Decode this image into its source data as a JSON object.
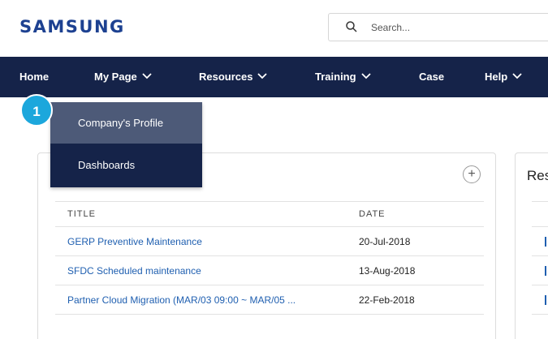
{
  "brand": {
    "logo_text": "SAMSUNG",
    "logo_color": "#1d4191"
  },
  "search": {
    "placeholder": "Search..."
  },
  "nav": {
    "bg_color": "#152349",
    "items": [
      {
        "label": "Home",
        "has_dropdown": false
      },
      {
        "label": "My Page",
        "has_dropdown": true
      },
      {
        "label": "Resources",
        "has_dropdown": true
      },
      {
        "label": "Training",
        "has_dropdown": true
      },
      {
        "label": "Case",
        "has_dropdown": false
      },
      {
        "label": "Help",
        "has_dropdown": true
      }
    ]
  },
  "dropdown": {
    "items": [
      {
        "label": "Company's Profile",
        "highlighted": true
      },
      {
        "label": "Dashboards",
        "highlighted": false
      }
    ]
  },
  "step_badge": {
    "number": "1",
    "color": "#1ca7dc"
  },
  "announcements": {
    "add_icon": "plus-icon",
    "columns": {
      "title": "TITLE",
      "date": "DATE"
    },
    "rows": [
      {
        "title": "GERP Preventive Maintenance",
        "date": "20-Jul-2018"
      },
      {
        "title": "SFDC Scheduled maintenance",
        "date": "13-Aug-2018"
      },
      {
        "title": "Partner Cloud Migration (MAR/03 09:00 ~ MAR/05 ...",
        "date": "22-Feb-2018"
      }
    ]
  },
  "second_card": {
    "title_partial": "Res"
  }
}
